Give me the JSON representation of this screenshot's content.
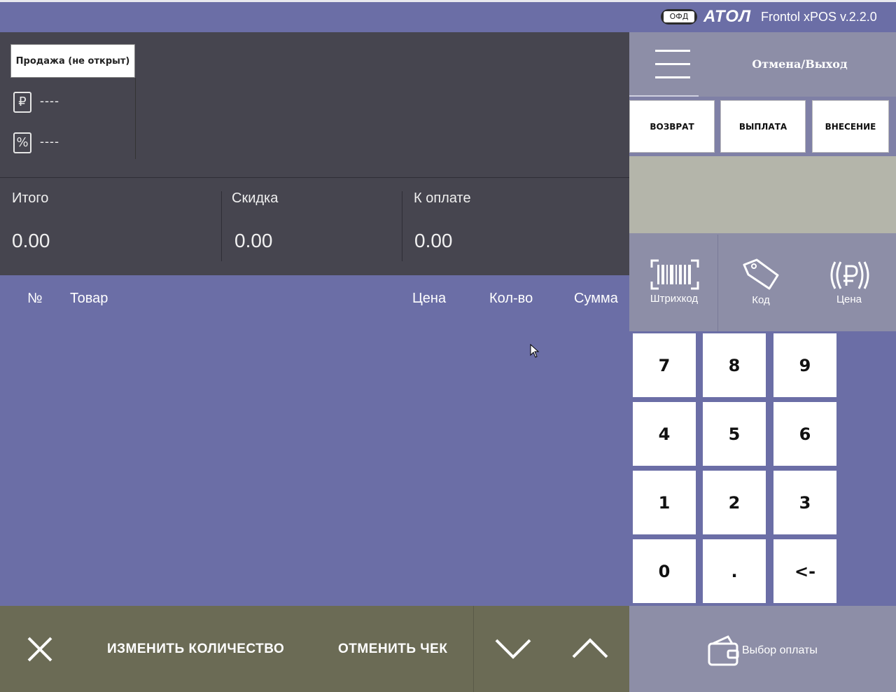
{
  "header": {
    "ofd_badge": "ОФД",
    "logo": "АТОЛ",
    "version": "Frontol xPOS v.2.2.0"
  },
  "info": {
    "sale_status": "Продажа (не открыт)",
    "ruble_icon_glyph": "₽",
    "percent_icon_glyph": "%",
    "ruble_value": "----",
    "percent_value": "----"
  },
  "totals": {
    "total_label": "Итого",
    "total_value": "0.00",
    "discount_label": "Скидка",
    "discount_value": "0.00",
    "to_pay_label": "К оплате",
    "to_pay_value": "0.00"
  },
  "receipt_table": {
    "columns": [
      "№",
      "Товар",
      "Цена",
      "Кол-во",
      "Сумма"
    ],
    "rows": []
  },
  "bottom_bar": {
    "change_qty": "ИЗМЕНИТЬ КОЛИЧЕСТВО",
    "cancel_receipt": "ОТМЕНИТЬ ЧЕК"
  },
  "right_panel": {
    "cancel_exit": "Отмена/Выход",
    "buttons": [
      "ВОЗВРАТ",
      "ВЫПЛАТА",
      "ВНЕСЕНИЕ"
    ],
    "input_modes": [
      "Штрихкод",
      "Код",
      "Цена"
    ],
    "keypad": [
      "7",
      "8",
      "9",
      "4",
      "5",
      "6",
      "1",
      "2",
      "3",
      "0",
      ".",
      "<-"
    ],
    "payment_choice": "Выбор оплаты"
  },
  "colors": {
    "accent_purple": "#6b6ea6",
    "dark_panel": "#46454f",
    "olive_bar": "#6b6b55",
    "light_purple": "#8d8ea7",
    "display_grey": "#b4b5aa"
  }
}
